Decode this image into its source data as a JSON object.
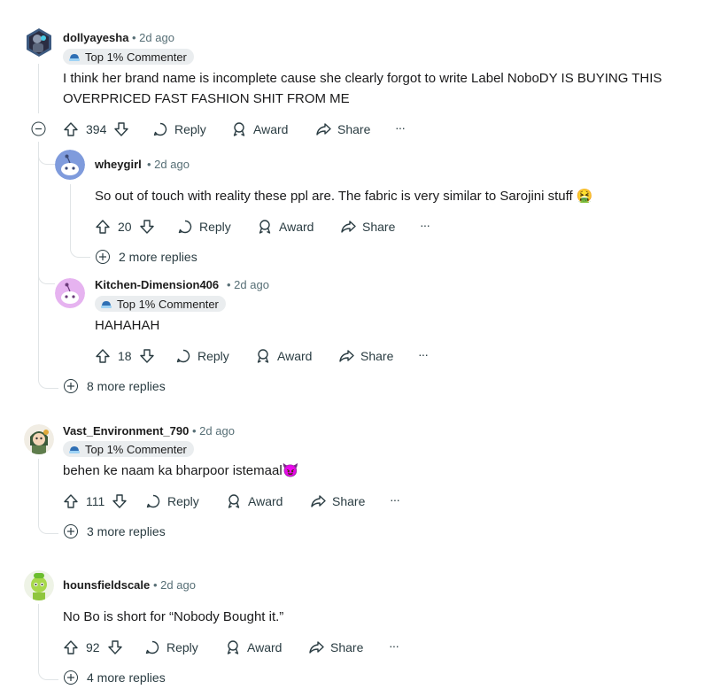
{
  "flair_text": "Top 1% Commenter",
  "actions": {
    "reply": "Reply",
    "award": "Award",
    "share": "Share",
    "more": "···"
  },
  "comments": [
    {
      "username": "dollyayesha",
      "time": "2d ago",
      "body": "I think her brand name is incomplete cause she clearly forgot to write Label NoboDY IS BUYING THIS OVERPRICED FAST FASHION SHIT FROM ME",
      "score": "394",
      "more_replies": "8 more replies"
    },
    {
      "username": "wheygirl",
      "time": "2d ago",
      "body": "So out of touch with reality these ppl are. The fabric is very similar to Sarojini stuff",
      "emoji": "🤮",
      "score": "20",
      "more_replies": "2 more replies"
    },
    {
      "username": "Kitchen-Dimension406",
      "time": "2d ago",
      "body": "HAHAHAH",
      "score": "18"
    },
    {
      "username": "Vast_Environment_790",
      "time": "2d ago",
      "body": "behen ke naam ka bharpoor istemaal",
      "emoji": "😈",
      "score": "111",
      "more_replies": "3 more replies"
    },
    {
      "username": "hounsfieldscale",
      "time": "2d ago",
      "body": "No Bo is short for “Nobody Bought it.”",
      "score": "92",
      "more_replies": "4 more replies"
    }
  ],
  "colors": {
    "text": "#1a1a1b",
    "meta": "#576f76",
    "flair_bg": "#eaedef",
    "thread_line": "#e0e4e6"
  },
  "icons": [
    "upvote-icon",
    "downvote-icon",
    "comment-icon",
    "award-icon",
    "share-icon",
    "overflow-icon",
    "collapse-icon",
    "expand-icon",
    "flair-icon"
  ]
}
